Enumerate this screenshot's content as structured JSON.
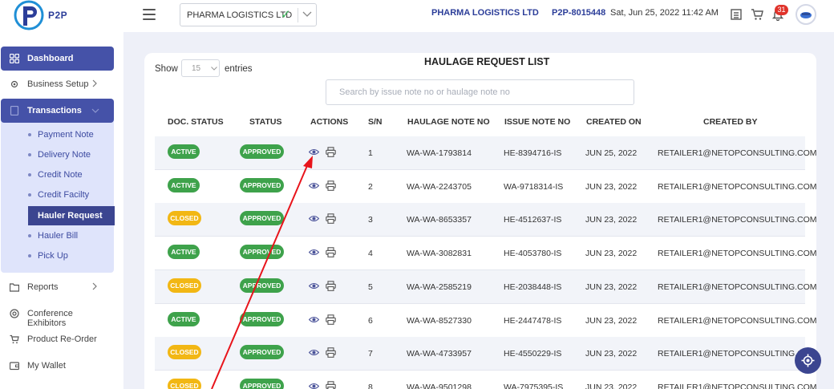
{
  "app": {
    "logo_text": "P2P",
    "company_select": "PHARMA LOGISTICS LTD",
    "company_name": "PHARMA LOGISTICS LTD",
    "account_code": "P2P-8015448",
    "datetime": "Sat, Jun 25, 2022 11:42 AM",
    "notification_count": "31",
    "icons": [
      "menu-icon",
      "check-icon",
      "chevron-down-icon",
      "receipt-icon",
      "cart-icon",
      "bell-icon",
      "avatar"
    ]
  },
  "sidebar": {
    "items": [
      {
        "label": "Dashboard",
        "icon": "grid-icon",
        "active": true
      },
      {
        "label": "Business Setup",
        "icon": "gear-icon"
      },
      {
        "label": "Transactions",
        "icon": "document-icon",
        "active": true
      },
      {
        "label": "Reports",
        "icon": "folder-icon"
      },
      {
        "label": "Conference Exhibitors",
        "icon": "target-icon"
      },
      {
        "label": "Product Re-Order",
        "icon": "cart-icon"
      },
      {
        "label": "My Wallet",
        "icon": "wallet-icon"
      }
    ],
    "sub_items": [
      {
        "label": "Payment Note"
      },
      {
        "label": "Delivery Note"
      },
      {
        "label": "Credit Note"
      },
      {
        "label": "Credit Facilty"
      },
      {
        "label": "Hauler Request",
        "active": true
      },
      {
        "label": "Hauler Bill"
      },
      {
        "label": "Pick Up"
      }
    ]
  },
  "list": {
    "title": "HAULAGE REQUEST LIST",
    "show_label": "Show",
    "entries_value": "15",
    "entries_label": "entries",
    "search_placeholder": "Search by issue note no or haulage note no",
    "columns": [
      "DOC. STATUS",
      "STATUS",
      "ACTIONS",
      "S/N",
      "HAULAGE NOTE NO",
      "ISSUE NOTE NO",
      "CREATED ON",
      "CREATED BY"
    ],
    "rows": [
      {
        "doc_status": "ACTIVE",
        "status": "APPROVED",
        "sn": "1",
        "haulage_no": "WA-WA-1793814",
        "issue_no": "HE-8394716-IS",
        "created_on": "JUN 25, 2022",
        "created_by": "RETAILER1@NETOPCONSULTING.COM"
      },
      {
        "doc_status": "ACTIVE",
        "status": "APPROVED",
        "sn": "2",
        "haulage_no": "WA-WA-2243705",
        "issue_no": "WA-9718314-IS",
        "created_on": "JUN 23, 2022",
        "created_by": "RETAILER1@NETOPCONSULTING.COM"
      },
      {
        "doc_status": "CLOSED",
        "status": "APPROVED",
        "sn": "3",
        "haulage_no": "WA-WA-8653357",
        "issue_no": "HE-4512637-IS",
        "created_on": "JUN 23, 2022",
        "created_by": "RETAILER1@NETOPCONSULTING.COM"
      },
      {
        "doc_status": "ACTIVE",
        "status": "APPROVED",
        "sn": "4",
        "haulage_no": "WA-WA-3082831",
        "issue_no": "HE-4053780-IS",
        "created_on": "JUN 23, 2022",
        "created_by": "RETAILER1@NETOPCONSULTING.COM"
      },
      {
        "doc_status": "CLOSED",
        "status": "APPROVED",
        "sn": "5",
        "haulage_no": "WA-WA-2585219",
        "issue_no": "HE-2038448-IS",
        "created_on": "JUN 23, 2022",
        "created_by": "RETAILER1@NETOPCONSULTING.COM"
      },
      {
        "doc_status": "ACTIVE",
        "status": "APPROVED",
        "sn": "6",
        "haulage_no": "WA-WA-8527330",
        "issue_no": "HE-2447478-IS",
        "created_on": "JUN 23, 2022",
        "created_by": "RETAILER1@NETOPCONSULTING.COM"
      },
      {
        "doc_status": "CLOSED",
        "status": "APPROVED",
        "sn": "7",
        "haulage_no": "WA-WA-4733957",
        "issue_no": "HE-4550229-IS",
        "created_on": "JUN 23, 2022",
        "created_by": "RETAILER1@NETOPCONSULTING.COM"
      },
      {
        "doc_status": "CLOSED",
        "status": "APPROVED",
        "sn": "8",
        "haulage_no": "WA-WA-9501298",
        "issue_no": "WA-7975395-IS",
        "created_on": "JUN 23, 2022",
        "created_by": "RETAILER1@NETOPCONSULTING.COM"
      }
    ],
    "row_action_icons": [
      "eye-icon",
      "print-icon"
    ]
  },
  "colors": {
    "primary": "#3b4590",
    "active_badge": "#3ea24b",
    "closed_badge": "#f2b714",
    "annotation_arrow": "#e8141b"
  }
}
